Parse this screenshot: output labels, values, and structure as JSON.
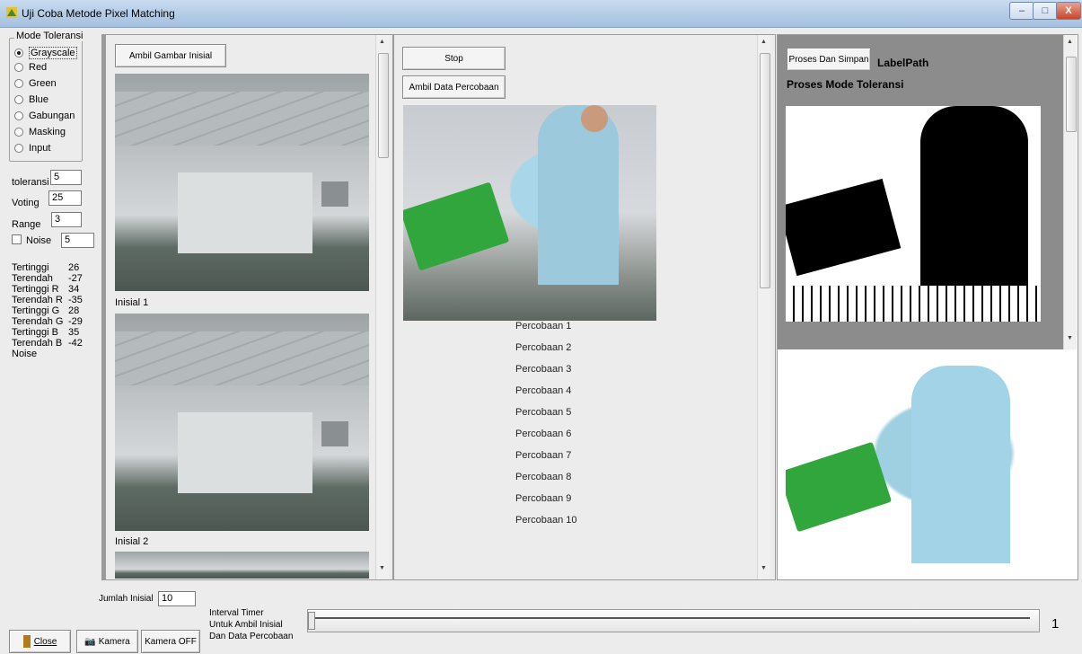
{
  "window": {
    "title": "Uji Coba Metode Pixel Matching",
    "minimize_glyph": "–",
    "maximize_glyph": "□",
    "close_glyph": "X"
  },
  "mode_toleransi": {
    "legend": "Mode Toleransi",
    "options": [
      "Grayscale",
      "Red",
      "Green",
      "Blue",
      "Gabungan",
      "Masking",
      "Input"
    ],
    "selected": "Grayscale"
  },
  "params": {
    "toleransi_label": "toleransi",
    "toleransi_value": "5",
    "voting_label": "Voting",
    "voting_value": "25",
    "range_label": "Range",
    "range_value": "3",
    "noise_label": "Noise",
    "noise_value": "5"
  },
  "stats": [
    {
      "label": "Tertinggi",
      "value": "26"
    },
    {
      "label": "Terendah",
      "value": "-27"
    },
    {
      "label": "Tertinggi R",
      "value": "34"
    },
    {
      "label": "Terendah R",
      "value": "-35"
    },
    {
      "label": "Tertinggi G",
      "value": "28"
    },
    {
      "label": "Terendah G",
      "value": "-29"
    },
    {
      "label": "Tertinggi B",
      "value": "35"
    },
    {
      "label": "Terendah B",
      "value": "-42"
    },
    {
      "label": "Noise",
      "value": ""
    }
  ],
  "panel_inisial": {
    "button": "Ambil Gambar Inisial",
    "captions": [
      "Inisial 1",
      "Inisial 2"
    ]
  },
  "panel_percobaan": {
    "stop_button": "Stop",
    "ambil_button": "Ambil Data Percobaan",
    "items": [
      "Percobaan 1",
      "Percobaan 2",
      "Percobaan 3",
      "Percobaan 4",
      "Percobaan 5",
      "Percobaan 6",
      "Percobaan 7",
      "Percobaan 8",
      "Percobaan 9",
      "Percobaan 10"
    ]
  },
  "panel_proses": {
    "button": "Proses Dan Simpan",
    "label_path": "LabelPath",
    "mode_label": "Proses Mode Toleransi"
  },
  "bottom": {
    "jumlah_label": "Jumlah Inisial",
    "jumlah_value": "10",
    "interval_lines": [
      "Interval Timer",
      "Untuk Ambil Inisial",
      "Dan Data Percobaan"
    ],
    "trackbar_value": "1",
    "close_button": "Close",
    "kamera_button": "Kamera",
    "kamera_off_button": "Kamera OFF"
  },
  "colors": {
    "titlebar": "#b3cbe6",
    "form_bg": "#ececec",
    "proses_bg": "#8c8c8c",
    "close_red": "#c8452b"
  }
}
